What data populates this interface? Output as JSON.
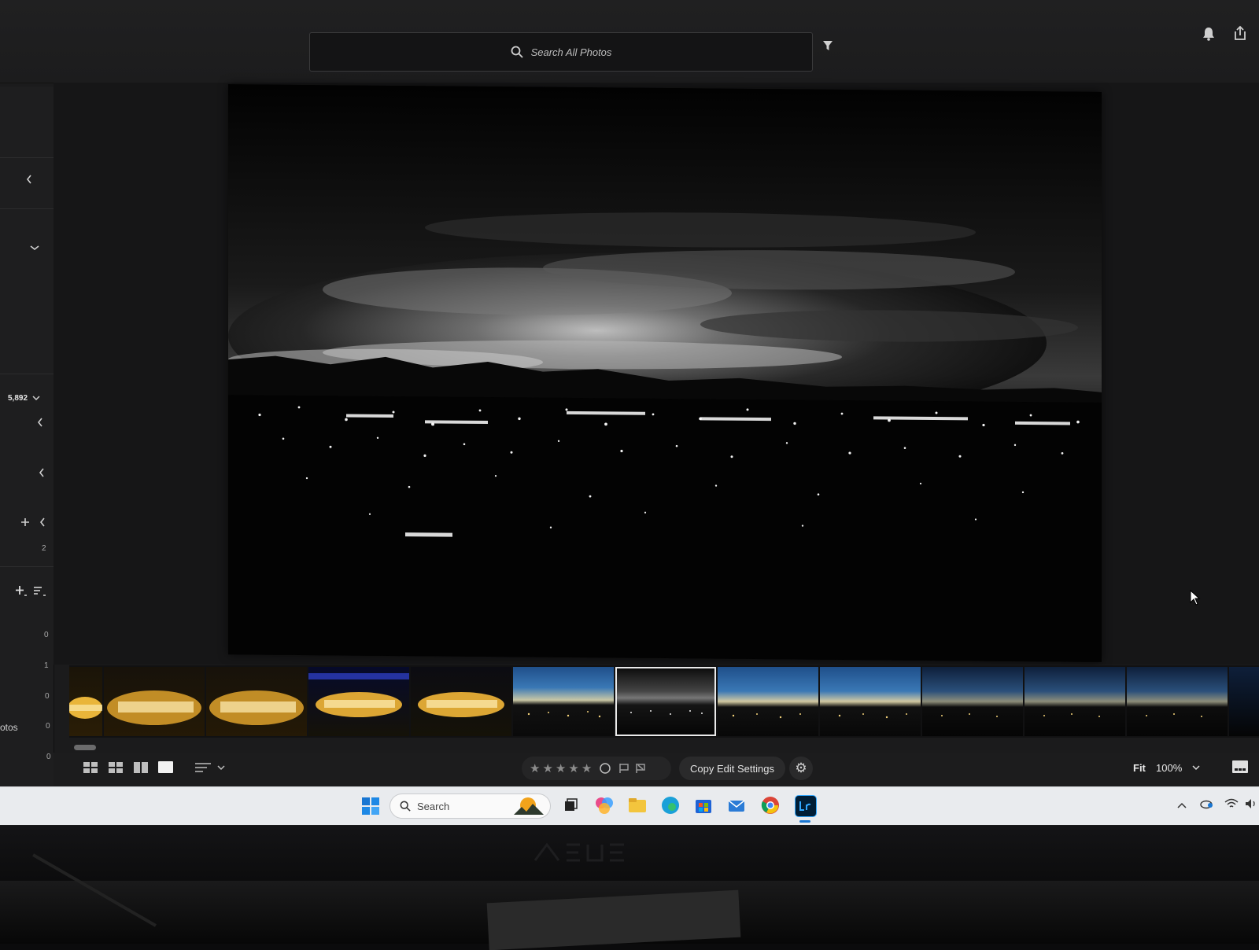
{
  "topbar": {
    "search_label": "Search All Photos"
  },
  "sidebar": {
    "count": "5,892",
    "num_2": "2",
    "rows": [
      {
        "label": "",
        "value": "0"
      },
      {
        "label": "",
        "value": "1"
      },
      {
        "label": "",
        "value": "0"
      },
      {
        "label": "otos",
        "value": "0"
      },
      {
        "label": "",
        "value": "0"
      }
    ]
  },
  "bottombar": {
    "copy_edit_label": "Copy Edit Settings",
    "fit_label": "Fit",
    "zoom_value": "100%"
  },
  "taskbar": {
    "search_label": "Search"
  },
  "icons": {
    "search": "search-icon",
    "filter": "filter-icon",
    "bell": "bell-icon",
    "share": "share-icon",
    "gear": "gear-icon"
  },
  "colors": {
    "panel": "#1b1b1c",
    "filmstrip": "#111112",
    "selected_outline": "#eaeaea",
    "taskbar": "#e9ebee"
  }
}
